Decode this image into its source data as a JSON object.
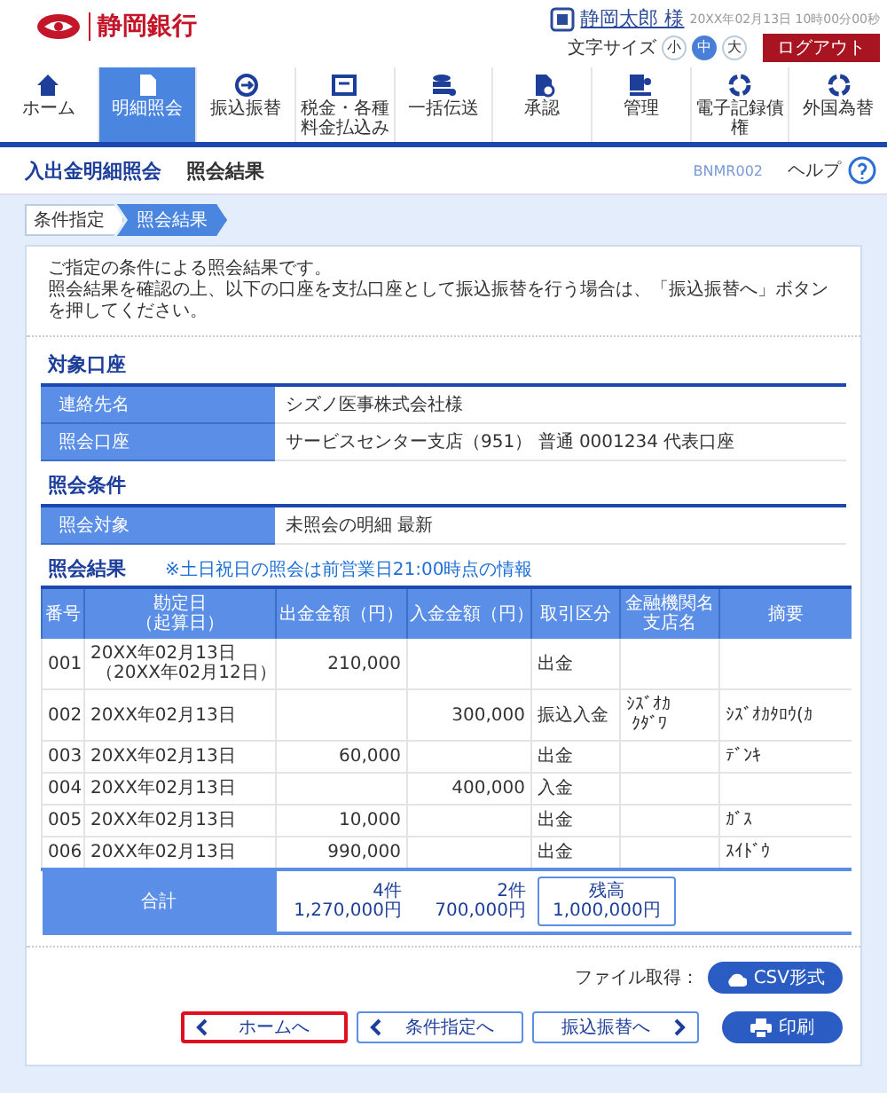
{
  "header": {
    "bank_name": "静岡銀行",
    "user_name": "静岡太郎 様",
    "datetime": "20XX年02月13日 10時00分00秒",
    "font_size_label": "文字サイズ",
    "font_sizes": [
      {
        "label": "小",
        "selected": false
      },
      {
        "label": "中",
        "selected": true
      },
      {
        "label": "大",
        "selected": false
      }
    ],
    "logout": "ログアウト"
  },
  "nav": [
    {
      "label": "ホーム",
      "selected": false
    },
    {
      "label": "明細照会",
      "selected": true
    },
    {
      "label": "振込振替",
      "selected": false
    },
    {
      "label": "税金・各種料金払込み",
      "selected": false
    },
    {
      "label": "一括伝送",
      "selected": false
    },
    {
      "label": "承認",
      "selected": false
    },
    {
      "label": "管理",
      "selected": false
    },
    {
      "label": "電子記録債権",
      "selected": false
    },
    {
      "label": "外国為替",
      "selected": false
    }
  ],
  "page_title": {
    "title": "入出金明細照会",
    "subtitle": "照会結果",
    "screen_id": "BNMR002",
    "help": "ヘルプ"
  },
  "steps": [
    {
      "label": "条件指定",
      "selected": false
    },
    {
      "label": "照会結果",
      "selected": true
    }
  ],
  "intro": [
    "ご指定の条件による照会結果です。",
    "照会結果を確認の上、以下の口座を支払口座として振込振替を行う場合は、「振込振替へ」ボタンを押してください。"
  ],
  "sections": [
    {
      "title": "対象口座",
      "rows": [
        {
          "label": "連絡先名",
          "value": "シズノ医事株式会社様"
        },
        {
          "label": "照会口座",
          "value": "サービスセンター支店（951） 普通 0001234 代表口座"
        }
      ]
    },
    {
      "title": "照会条件",
      "rows": [
        {
          "label": "照会対象",
          "value": "未照会の明細 最新"
        }
      ]
    }
  ],
  "results": {
    "title": "照会結果",
    "note": "※土日祝日の照会は前営業日21:00時点の情報",
    "columns": [
      {
        "label": "番号"
      },
      {
        "label": "勘定日",
        "sub": "（起算日）"
      },
      {
        "label": "出金金額（円）"
      },
      {
        "label": "入金金額（円）"
      },
      {
        "label": "取引区分"
      },
      {
        "label": "金融機関名",
        "sub": "支店名"
      },
      {
        "label": "摘要"
      }
    ],
    "rows": [
      [
        "001",
        {
          "text": "20XX年02月13日",
          "sub": "（20XX年02月12日）"
        },
        "210,000",
        null,
        "出金",
        null,
        null
      ],
      [
        "002",
        "20XX年02月13日",
        null,
        "300,000",
        "振込入金",
        {
          "text": "ｼｽﾞｵｶ",
          "sub": "ｸﾀﾞﾜ"
        },
        "ｼｽﾞｵｶﾀﾛｳ(ｶ"
      ],
      [
        "003",
        "20XX年02月13日",
        "60,000",
        null,
        "出金",
        null,
        "ﾃﾞﾝｷ"
      ],
      [
        "004",
        "20XX年02月13日",
        null,
        "400,000",
        "入金",
        null,
        null
      ],
      [
        "005",
        "20XX年02月13日",
        "10,000",
        null,
        "出金",
        null,
        "ｶﾞｽ"
      ],
      [
        "006",
        "20XX年02月13日",
        "990,000",
        null,
        "出金",
        null,
        "ｽｲﾄﾞｳ"
      ]
    ],
    "total": {
      "label": "合計",
      "withdrawal": {
        "count": "4件",
        "amount": "1,270,000円"
      },
      "deposit": {
        "count": "2件",
        "amount": "700,000円"
      },
      "balance": {
        "label": "残高",
        "amount": "1,000,000円"
      }
    }
  },
  "file_label": "ファイル取得：",
  "csv_button": "CSV形式",
  "buttons": [
    {
      "label": "ホームへ",
      "kind": "back",
      "highlighted": true
    },
    {
      "label": "条件指定へ",
      "kind": "back",
      "highlighted": false
    },
    {
      "label": "振込振替へ",
      "kind": "forward",
      "highlighted": false
    }
  ],
  "print_button": "印刷"
}
